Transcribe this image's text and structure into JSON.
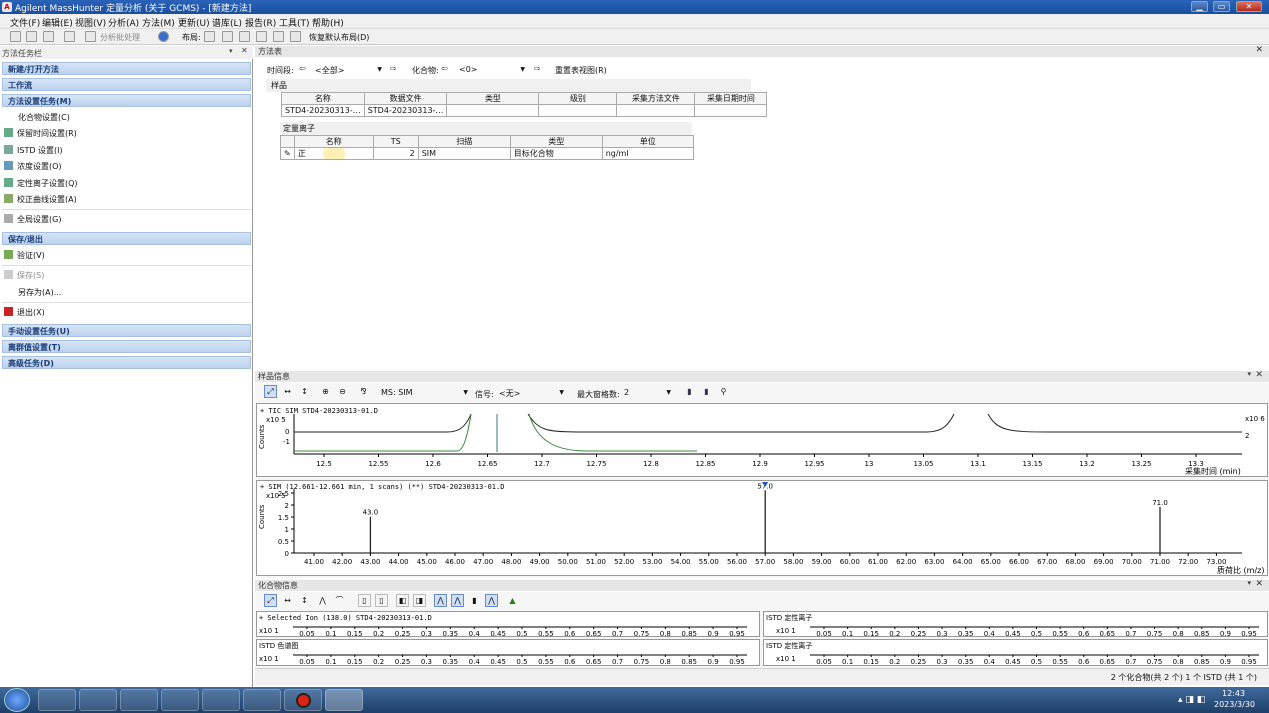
{
  "window": {
    "title": "Agilent MassHunter 定量分析 (关于 GCMS) - [新建方法]",
    "min": "▁",
    "max": "▭",
    "close": "✕"
  },
  "menu": [
    "文件(F)",
    "编辑(E)",
    "视图(V)",
    "分析(A)",
    "方法(M)",
    "更新(U)",
    "谱库(L)",
    "报告(R)",
    "工具(T)",
    "帮助(H)"
  ],
  "toolbar": {
    "batch": "分析批处理",
    "layout": "布局:",
    "restore": "恢复默认布局(D)"
  },
  "left": {
    "title": "方法任务栏",
    "sections": {
      "new_open": "新建/打开方法",
      "workflow": "工作流",
      "setup": "方法设置任务(M)",
      "save_exit": "保存/退出",
      "manual": "手动设置任务(U)",
      "outlier": "离群值设置(T)",
      "advanced": "高级任务(D)"
    },
    "items": {
      "compound": "化合物设置(C)",
      "rt": "保留时间设置(R)",
      "istd": "ISTD 设置(I)",
      "conc": "浓度设置(O)",
      "qual": "定性离子设置(Q)",
      "calib": "校正曲线设置(A)",
      "global": "全局设置(G)",
      "validate": "验证(V)",
      "save": "保存(S)",
      "saveas": "另存为(A)...",
      "exit": "退出(X)"
    }
  },
  "method_table": {
    "title": "方法表",
    "time_seg_label": "时间段:",
    "time_seg_value": "<全部>",
    "compound_label": "化合物:",
    "compound_value": "<0>",
    "reset": "重置表视图(R)",
    "sample_group": "样品",
    "sample_cols": [
      "名称",
      "数据文件",
      "类型",
      "级别",
      "采集方法文件",
      "采集日期时间"
    ],
    "sample_row": [
      "STD4-20230313-…",
      "STD4-20230313-…",
      "",
      "",
      "",
      ""
    ],
    "quant_group": "定量离子",
    "quant_cols": [
      "名称",
      "TS",
      "扫描",
      "类型",
      "单位"
    ],
    "quant_row": [
      "正",
      "2",
      "SIM",
      "目标化合物",
      "ng/ml"
    ]
  },
  "sample_info": {
    "title": "样品信息",
    "ms_value": "MS: SIM",
    "signal_label": "信号:",
    "signal_value": "<无>",
    "max_panes_label": "最大窗格数:",
    "max_panes_value": "2",
    "tic_header": "+ TIC SIM STD4-20230313-01.D",
    "tic_ylabel": "Counts",
    "tic_yscale": "x10 5",
    "tic_right_scale": "x10 6",
    "tic_yticks": [
      "0",
      "-1",
      "2"
    ],
    "tic_xlabel": "采集时间 (min)",
    "tic_xticks": [
      "12.5",
      "12.55",
      "12.6",
      "12.65",
      "12.7",
      "12.75",
      "12.8",
      "12.85",
      "12.9",
      "12.95",
      "13",
      "13.05",
      "13.1",
      "13.15",
      "13.2",
      "13.25",
      "13.3"
    ],
    "sim_header": "+ SIM (12.661-12.661 min, 1 scans) (**) STD4-20230313-01.D",
    "sim_ylabel": "Counts",
    "sim_yscale": "x10 5",
    "sim_yticks": [
      "2.5",
      "2",
      "1.5",
      "1",
      "0.5",
      "0"
    ],
    "sim_xlabel": "质荷比 (m/z)",
    "sim_xticks": [
      "41.00",
      "42.00",
      "43.00",
      "44.00",
      "45.00",
      "46.00",
      "47.00",
      "48.00",
      "49.00",
      "50.00",
      "51.00",
      "52.00",
      "53.00",
      "54.00",
      "55.00",
      "56.00",
      "57.00",
      "58.00",
      "59.00",
      "60.00",
      "61.00",
      "62.00",
      "63.00",
      "64.00",
      "65.00",
      "66.00",
      "67.00",
      "68.00",
      "69.00",
      "70.00",
      "71.00",
      "72.00",
      "73.00"
    ],
    "peaks": [
      {
        "mz": 43.0,
        "label": "43.0",
        "rel": 0.55
      },
      {
        "mz": 57.0,
        "label": "57.0",
        "rel": 0.95
      },
      {
        "mz": 71.0,
        "label": "71.0",
        "rel": 0.7
      }
    ]
  },
  "compound_info": {
    "title": "化合物信息",
    "p1_header": "+ Selected Ion (138.0) STD4-20230313-01.D",
    "p2_header": "ISTD 定性离子",
    "p3_header": "ISTD 色谱图",
    "p4_header": "ISTD 定性离子",
    "scale": "x10 1",
    "ticks": [
      "0.05",
      "0.1",
      "0.15",
      "0.2",
      "0.25",
      "0.3",
      "0.35",
      "0.4",
      "0.45",
      "0.5",
      "0.55",
      "0.6",
      "0.65",
      "0.7",
      "0.75",
      "0.8",
      "0.85",
      "0.9",
      "0.95"
    ]
  },
  "status": {
    "text": "2 个化合物(共 2 个) 1 个 ISTD (共 1 个)"
  },
  "clock": {
    "time": "12:43",
    "date": "2023/3/30"
  }
}
